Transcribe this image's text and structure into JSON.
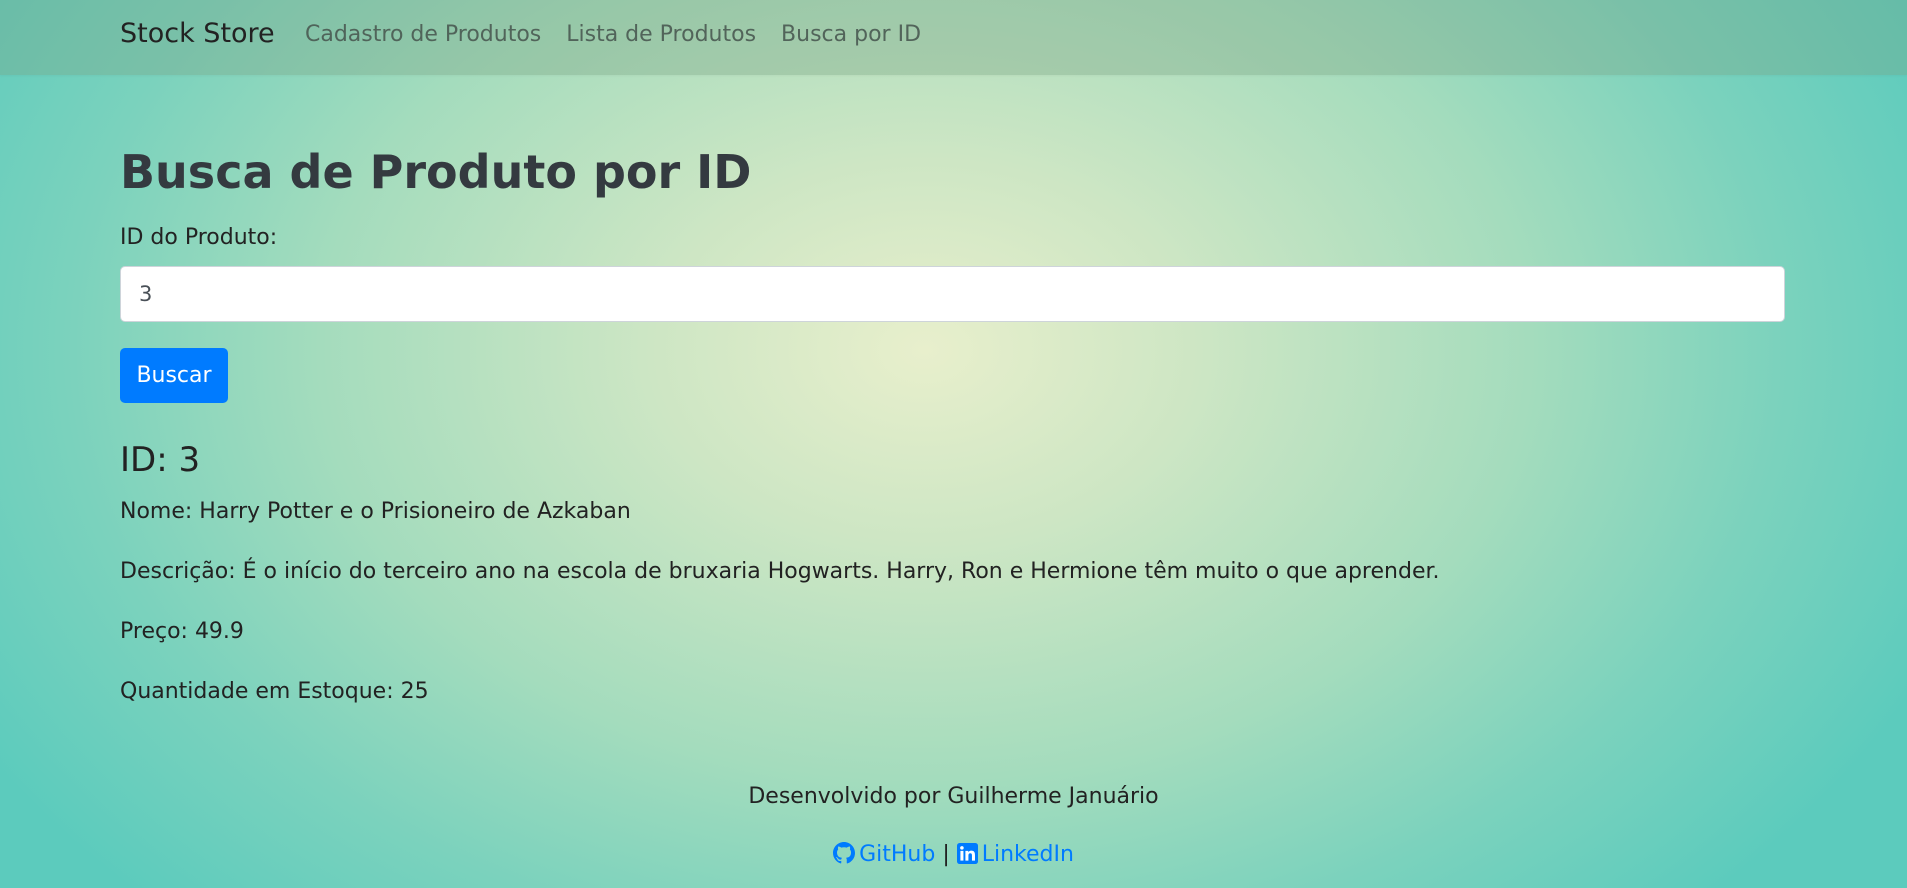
{
  "navbar": {
    "brand": "Stock Store",
    "links": [
      {
        "label": "Cadastro de Produtos"
      },
      {
        "label": "Lista de Produtos"
      },
      {
        "label": "Busca por ID"
      }
    ]
  },
  "main": {
    "title": "Busca de Produto por ID",
    "input_label": "ID do Produto:",
    "input_value": "3",
    "search_button": "Buscar"
  },
  "result": {
    "id_heading": "ID: 3",
    "name": "Nome: Harry Potter e o Prisioneiro de Azkaban",
    "description": "Descrição: É o início do terceiro ano na escola de bruxaria Hogwarts. Harry, Ron e Hermione têm muito o que aprender.",
    "price": "Preço: 49.9",
    "stock": "Quantidade em Estoque: 25"
  },
  "footer": {
    "credit": "Desenvolvido por Guilherme Januário",
    "github_label": "GitHub",
    "separator": "|",
    "linkedin_label": "LinkedIn",
    "github_icon": "github-icon",
    "linkedin_icon": "linkedin-icon"
  },
  "colors": {
    "primary": "#007bff",
    "link": "#007bff"
  }
}
